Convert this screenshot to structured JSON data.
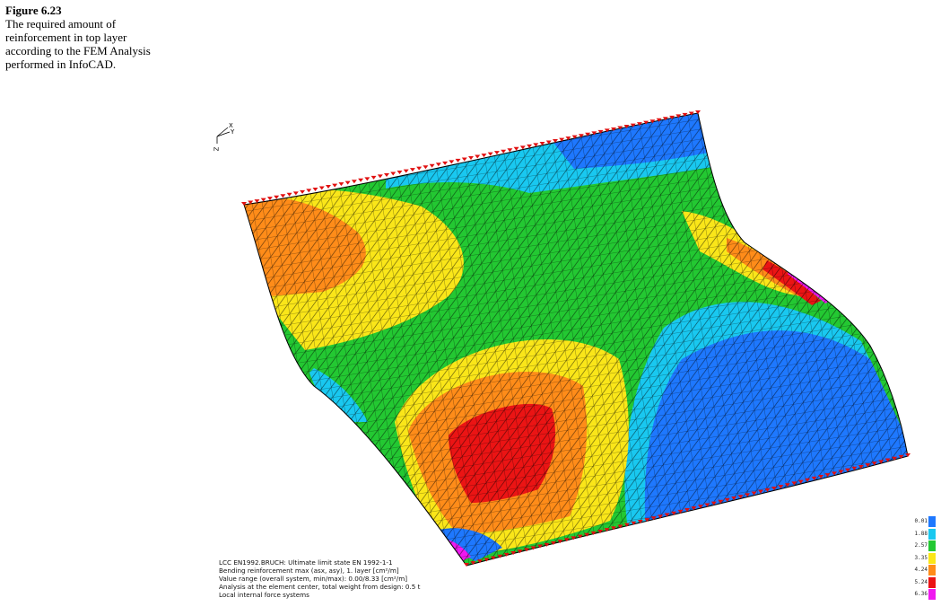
{
  "caption": {
    "figure_number": "Figure 6.23",
    "lines": [
      "The required amount of",
      "reinforcement in top layer",
      "according to the FEM Analysis",
      "performed in InfoCAD."
    ]
  },
  "axis_labels": {
    "x": "X",
    "y": "Y",
    "z": "Z"
  },
  "info_lines": [
    "LCC EN1992.BRUCH: Ultimate limit state EN 1992-1-1",
    "Bending reinforcement max (asx, asy), 1. layer [cm²/m]",
    "Value range (overall system, min/max): 0.00/8.33 [cm²/m]",
    "Analysis at the element center, total weight from design: 0.5 t",
    "Local internal force systems"
  ],
  "legend": {
    "values": [
      "0.01",
      "1.88",
      "2.57",
      "3.35",
      "4.24",
      "5.24",
      "6.36"
    ],
    "colors": [
      "#1e78ff",
      "#19c8f0",
      "#23c832",
      "#fae619",
      "#ff8c19",
      "#eb1414",
      "#f019f0"
    ]
  }
}
